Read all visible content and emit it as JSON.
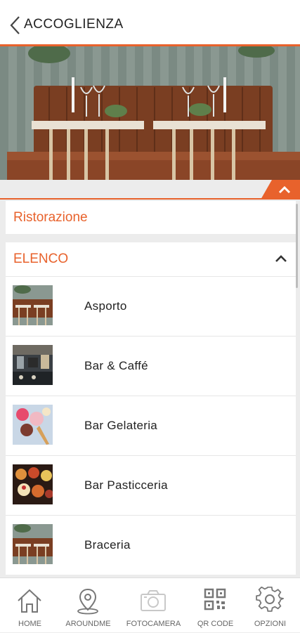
{
  "header": {
    "title": "ACCOGLIENZA",
    "back_icon": "chevron-left-icon"
  },
  "colors": {
    "accent": "#e8622c",
    "text": "#222222",
    "nav_text": "#666666",
    "background": "#ececec"
  },
  "hero": {
    "image": "restaurant-interior-image",
    "collapse_icon": "chevron-up-icon"
  },
  "section": {
    "title": "Ristorazione"
  },
  "list": {
    "header": "ELENCO",
    "toggle_icon": "chevron-up-icon",
    "items": [
      {
        "label": "Asporto",
        "thumb": "restaurant-thumb"
      },
      {
        "label": "Bar & Caffé",
        "thumb": "bar-thumb"
      },
      {
        "label": "Bar Gelateria",
        "thumb": "gelato-thumb"
      },
      {
        "label": "Bar Pasticceria",
        "thumb": "pastry-thumb"
      },
      {
        "label": "Braceria",
        "thumb": "restaurant-thumb"
      }
    ]
  },
  "nav": [
    {
      "label": "HOME",
      "icon": "home-icon"
    },
    {
      "label": "AROUNDME",
      "icon": "location-pin-icon"
    },
    {
      "label": "FOTOCAMERA",
      "icon": "camera-icon"
    },
    {
      "label": "QR CODE",
      "icon": "qr-code-icon"
    },
    {
      "label": "OPZIONI",
      "icon": "gear-icon"
    }
  ]
}
